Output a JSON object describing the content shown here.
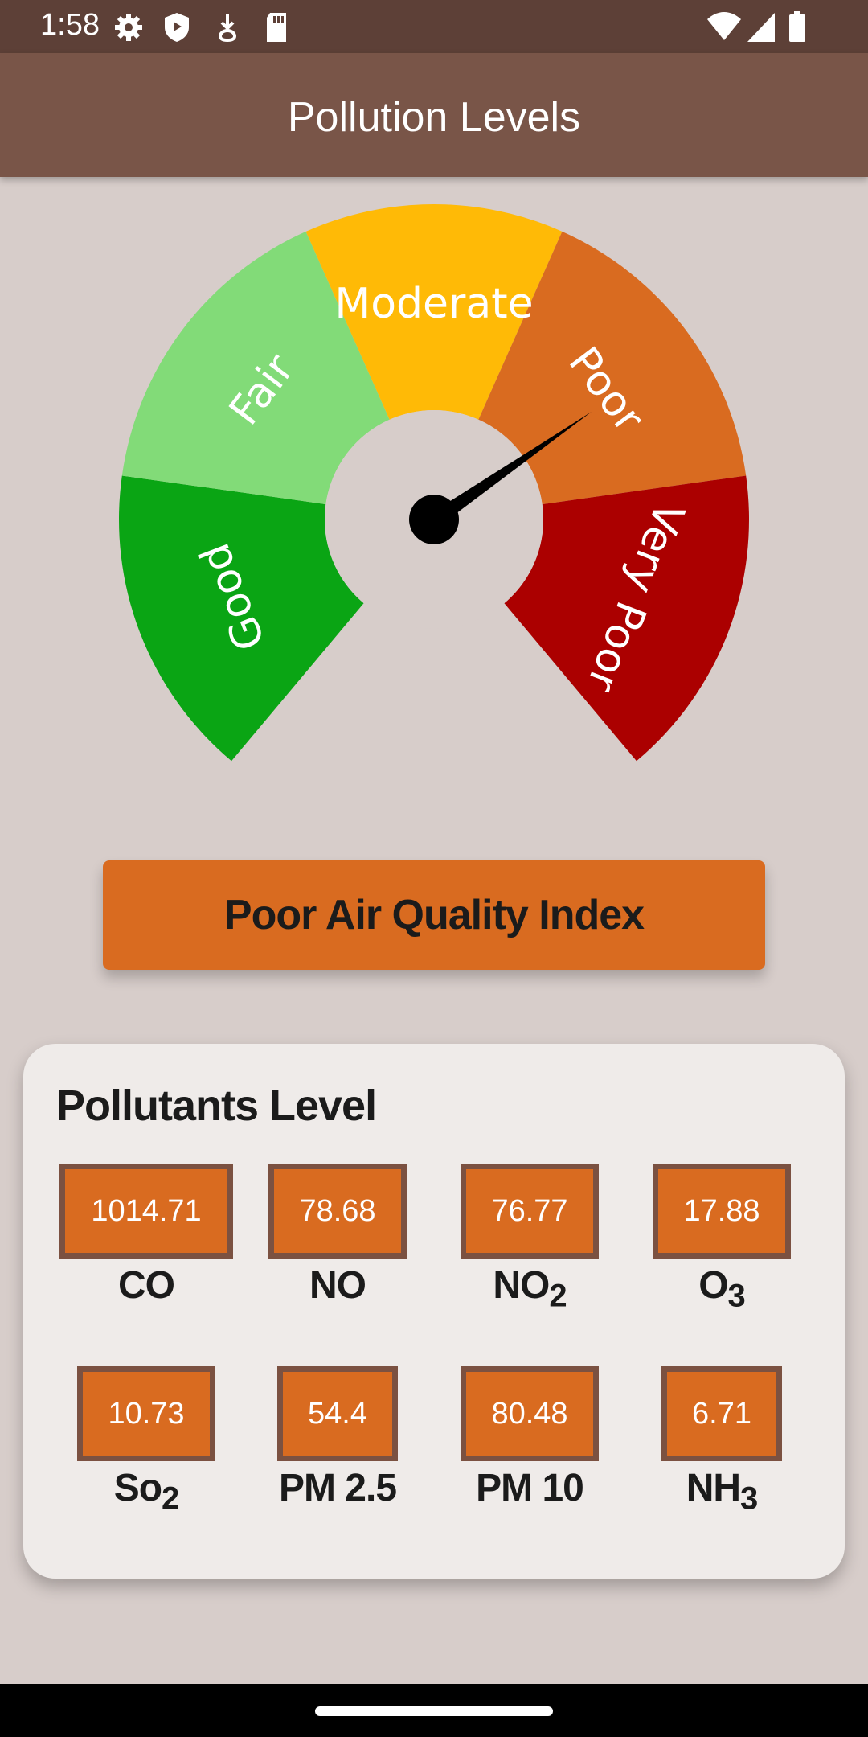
{
  "status_bar": {
    "time": "1:58",
    "left_icons": [
      "gear-icon",
      "shield-icon",
      "download-icon",
      "sd-card-icon"
    ],
    "right_icons": [
      "wifi-icon",
      "signal-icon",
      "battery-icon"
    ]
  },
  "app_bar": {
    "title": "Pollution Levels"
  },
  "gauge": {
    "segments": [
      {
        "label": "Good",
        "color": "#0aa514"
      },
      {
        "label": "Fair",
        "color": "#82db78"
      },
      {
        "label": "Moderate",
        "color": "#ffba06"
      },
      {
        "label": "Poor",
        "color": "#d96b20"
      },
      {
        "label": "Very Poor",
        "color": "#ab0000"
      }
    ],
    "current_level": "Poor"
  },
  "aqi_button": {
    "label": "Poor Air Quality Index",
    "color": "#d96b20"
  },
  "pollutants": {
    "title": "Pollutants Level",
    "items": [
      {
        "value": "1014.71",
        "name": "CO",
        "sub": ""
      },
      {
        "value": "78.68",
        "name": "NO",
        "sub": ""
      },
      {
        "value": "76.77",
        "name": "NO",
        "sub": "2"
      },
      {
        "value": "17.88",
        "name": "O",
        "sub": "3"
      },
      {
        "value": "10.73",
        "name": "So",
        "sub": "2"
      },
      {
        "value": "54.4",
        "name": "PM 2.5",
        "sub": ""
      },
      {
        "value": "80.48",
        "name": "PM 10",
        "sub": ""
      },
      {
        "value": "6.71",
        "name": "NH",
        "sub": "3"
      }
    ]
  }
}
